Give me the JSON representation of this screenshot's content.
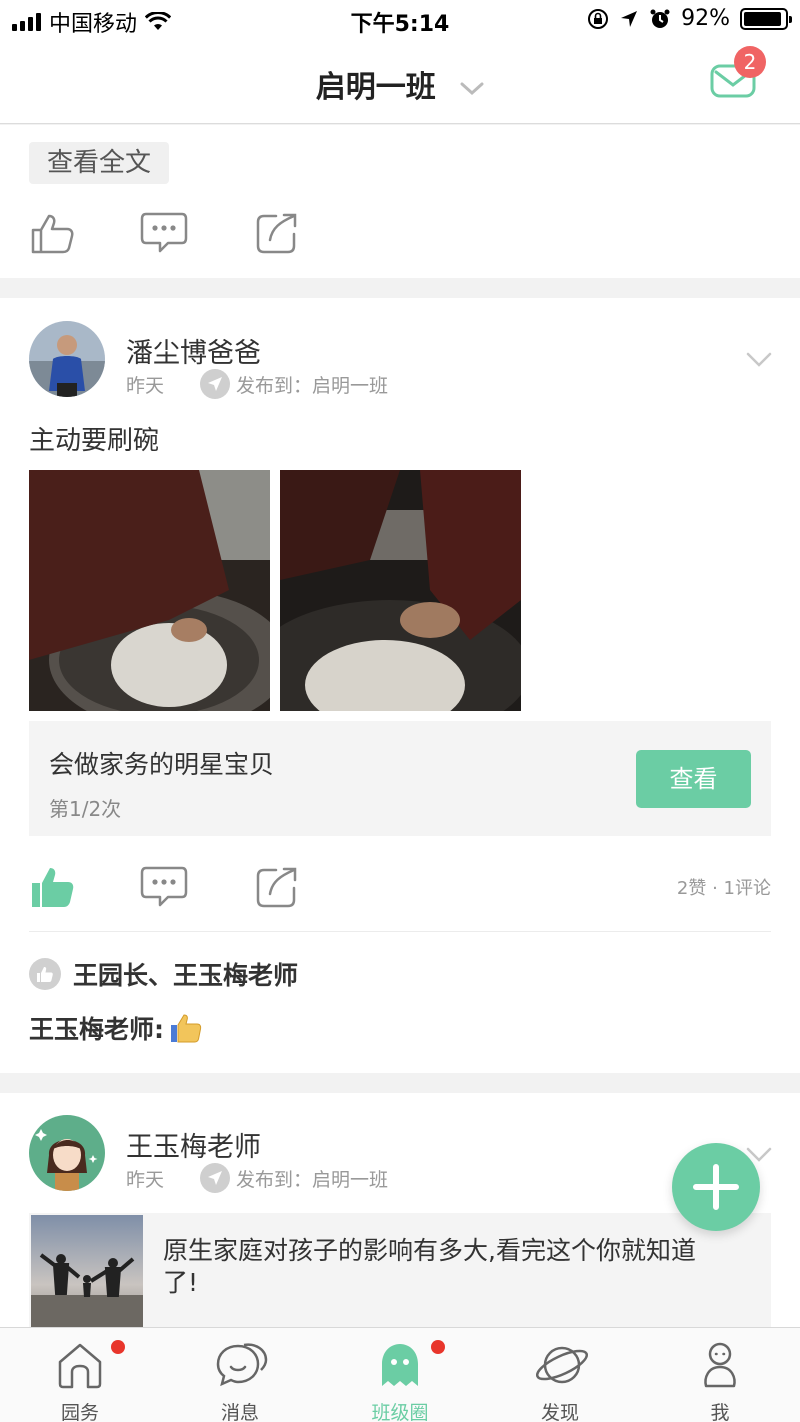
{
  "status_bar": {
    "carrier": "中国移动",
    "time": "下午5:14",
    "battery": "92%",
    "battery_level": 0.92
  },
  "nav": {
    "title": "启明一班",
    "mail_badge": "2"
  },
  "post_prev": {
    "view_full": "查看全文"
  },
  "post1": {
    "author": "潘尘博爸爸",
    "time": "昨天",
    "published_to": "发布到：启明一班",
    "text": "主动要刷碗",
    "task": {
      "title": "会做家务的明星宝贝",
      "progress": "第1/2次",
      "button": "查看"
    },
    "counts": "2赞 · 1评论",
    "likers": "王园长、王玉梅老师",
    "comment": "王玉梅老师:"
  },
  "post2": {
    "author": "王玉梅老师",
    "time": "昨天",
    "published_to": "发布到：启明一班",
    "link_title": "原生家庭对孩子的影响有多大,看完这个你就知道了!"
  },
  "tabs": [
    {
      "label": "园务",
      "icon": "house-icon",
      "badge": true
    },
    {
      "label": "消息",
      "icon": "chat-icon",
      "badge": false
    },
    {
      "label": "班级圈",
      "icon": "ghost-icon",
      "badge": true,
      "active": true
    },
    {
      "label": "发现",
      "icon": "planet-icon",
      "badge": false
    },
    {
      "label": "我",
      "icon": "person-icon",
      "badge": false
    }
  ],
  "colors": {
    "accent": "#6bcda4",
    "badge": "#f06464",
    "dot": "#e8352b"
  }
}
